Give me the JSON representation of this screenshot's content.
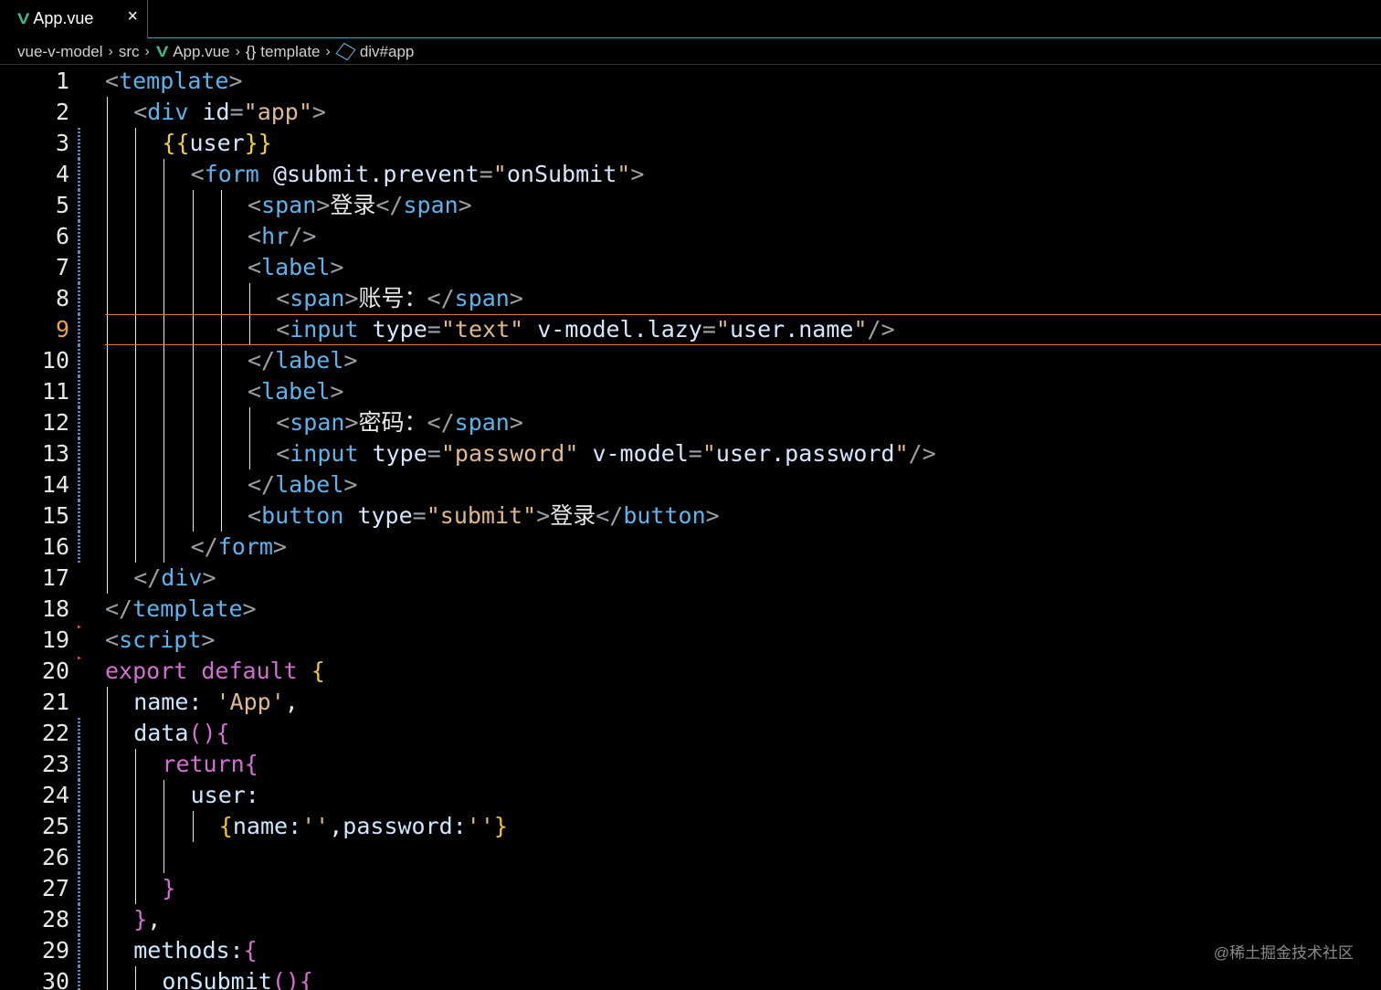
{
  "tab": {
    "icon": "vue-logo-icon",
    "label": "App.vue",
    "close": "×"
  },
  "breadcrumb": {
    "project": "vue-v-model",
    "folder": "src",
    "file": "App.vue",
    "section_icon": "{}",
    "section": "template",
    "element": "div#app"
  },
  "editor": {
    "active_line": 9,
    "lines": [
      {
        "n": "1",
        "indent": 0,
        "tokens": [
          [
            "t-punc",
            "<"
          ],
          [
            "t-tag",
            "template"
          ],
          [
            "t-punc",
            ">"
          ]
        ]
      },
      {
        "n": "2",
        "indent": 1,
        "tokens": [
          [
            "t-punc",
            "<"
          ],
          [
            "t-tag",
            "div"
          ],
          [
            "t-text",
            " "
          ],
          [
            "t-attr",
            "id"
          ],
          [
            "t-punc",
            "="
          ],
          [
            "t-str",
            "\"app\""
          ],
          [
            "t-punc",
            ">"
          ]
        ]
      },
      {
        "n": "3",
        "indent": 2,
        "tokens": [
          [
            "t-mus",
            "{{"
          ],
          [
            "t-attr",
            "user"
          ],
          [
            "t-mus",
            "}}"
          ]
        ]
      },
      {
        "n": "4",
        "indent": 3,
        "tokens": [
          [
            "t-punc",
            "<"
          ],
          [
            "t-tag",
            "form"
          ],
          [
            "t-text",
            " "
          ],
          [
            "t-attr",
            "@submit.prevent"
          ],
          [
            "t-punc",
            "="
          ],
          [
            "t-str",
            "\""
          ],
          [
            "t-attr",
            "onSubmit"
          ],
          [
            "t-str",
            "\""
          ],
          [
            "t-punc",
            ">"
          ]
        ]
      },
      {
        "n": "5",
        "indent": 5,
        "tokens": [
          [
            "t-punc",
            "<"
          ],
          [
            "t-tag",
            "span"
          ],
          [
            "t-punc",
            ">"
          ],
          [
            "t-text",
            "登录"
          ],
          [
            "t-punc",
            "</"
          ],
          [
            "t-tag",
            "span"
          ],
          [
            "t-punc",
            ">"
          ]
        ]
      },
      {
        "n": "6",
        "indent": 5,
        "tokens": [
          [
            "t-punc",
            "<"
          ],
          [
            "t-tag",
            "hr"
          ],
          [
            "t-punc",
            "/>"
          ]
        ]
      },
      {
        "n": "7",
        "indent": 5,
        "tokens": [
          [
            "t-punc",
            "<"
          ],
          [
            "t-tag",
            "label"
          ],
          [
            "t-punc",
            ">"
          ]
        ]
      },
      {
        "n": "8",
        "indent": 6,
        "tokens": [
          [
            "t-punc",
            "<"
          ],
          [
            "t-tag",
            "span"
          ],
          [
            "t-punc",
            ">"
          ],
          [
            "t-text",
            "账号："
          ],
          [
            "t-punc",
            "</"
          ],
          [
            "t-tag",
            "span"
          ],
          [
            "t-punc",
            ">"
          ]
        ]
      },
      {
        "n": "9",
        "indent": 6,
        "tokens": [
          [
            "t-punc",
            "<"
          ],
          [
            "t-tag",
            "input"
          ],
          [
            "t-text",
            " "
          ],
          [
            "t-attr",
            "type"
          ],
          [
            "t-punc",
            "="
          ],
          [
            "t-str",
            "\"text\""
          ],
          [
            "t-text",
            " "
          ],
          [
            "t-attr",
            "v-model.lazy"
          ],
          [
            "t-punc",
            "="
          ],
          [
            "t-str",
            "\""
          ],
          [
            "t-attr",
            "user.name"
          ],
          [
            "t-str",
            "\""
          ],
          [
            "t-punc",
            "/>"
          ]
        ]
      },
      {
        "n": "10",
        "indent": 5,
        "tokens": [
          [
            "t-punc",
            "</"
          ],
          [
            "t-tag",
            "label"
          ],
          [
            "t-punc",
            ">"
          ]
        ]
      },
      {
        "n": "11",
        "indent": 5,
        "tokens": [
          [
            "t-punc",
            "<"
          ],
          [
            "t-tag",
            "label"
          ],
          [
            "t-punc",
            ">"
          ]
        ]
      },
      {
        "n": "12",
        "indent": 6,
        "tokens": [
          [
            "t-punc",
            "<"
          ],
          [
            "t-tag",
            "span"
          ],
          [
            "t-punc",
            ">"
          ],
          [
            "t-text",
            "密码："
          ],
          [
            "t-punc",
            "</"
          ],
          [
            "t-tag",
            "span"
          ],
          [
            "t-punc",
            ">"
          ]
        ]
      },
      {
        "n": "13",
        "indent": 6,
        "tokens": [
          [
            "t-punc",
            "<"
          ],
          [
            "t-tag",
            "input"
          ],
          [
            "t-text",
            " "
          ],
          [
            "t-attr",
            "type"
          ],
          [
            "t-punc",
            "="
          ],
          [
            "t-str",
            "\"password\""
          ],
          [
            "t-text",
            " "
          ],
          [
            "t-attr",
            "v-model"
          ],
          [
            "t-punc",
            "="
          ],
          [
            "t-str",
            "\""
          ],
          [
            "t-attr",
            "user.password"
          ],
          [
            "t-str",
            "\""
          ],
          [
            "t-punc",
            "/>"
          ]
        ]
      },
      {
        "n": "14",
        "indent": 5,
        "tokens": [
          [
            "t-punc",
            "</"
          ],
          [
            "t-tag",
            "label"
          ],
          [
            "t-punc",
            ">"
          ]
        ]
      },
      {
        "n": "15",
        "indent": 5,
        "tokens": [
          [
            "t-punc",
            "<"
          ],
          [
            "t-tag",
            "button"
          ],
          [
            "t-text",
            " "
          ],
          [
            "t-attr",
            "type"
          ],
          [
            "t-punc",
            "="
          ],
          [
            "t-str",
            "\"submit\""
          ],
          [
            "t-punc",
            ">"
          ],
          [
            "t-text",
            "登录"
          ],
          [
            "t-punc",
            "</"
          ],
          [
            "t-tag",
            "button"
          ],
          [
            "t-punc",
            ">"
          ]
        ]
      },
      {
        "n": "16",
        "indent": 3,
        "tokens": [
          [
            "t-punc",
            "</"
          ],
          [
            "t-tag",
            "form"
          ],
          [
            "t-punc",
            ">"
          ]
        ]
      },
      {
        "n": "17",
        "indent": 1,
        "tokens": [
          [
            "t-punc",
            "</"
          ],
          [
            "t-tag",
            "div"
          ],
          [
            "t-punc",
            ">"
          ]
        ]
      },
      {
        "n": "18",
        "indent": 0,
        "tokens": [
          [
            "t-punc",
            "</"
          ],
          [
            "t-tag",
            "template"
          ],
          [
            "t-punc",
            ">"
          ]
        ]
      },
      {
        "n": "19",
        "indent": 0,
        "tokens": [
          [
            "t-punc",
            "<"
          ],
          [
            "t-tag",
            "script"
          ],
          [
            "t-punc",
            ">"
          ]
        ]
      },
      {
        "n": "20",
        "indent": 0,
        "tokens": [
          [
            "t-kw",
            "export default"
          ],
          [
            "t-text",
            " "
          ],
          [
            "t-brace",
            "{"
          ]
        ]
      },
      {
        "n": "21",
        "indent": 1,
        "tokens": [
          [
            "t-prop",
            "name: "
          ],
          [
            "t-str",
            "'App'"
          ],
          [
            "t-text",
            ","
          ]
        ]
      },
      {
        "n": "22",
        "indent": 1,
        "tokens": [
          [
            "t-prop",
            "data"
          ],
          [
            "t-brace2",
            "(){"
          ]
        ]
      },
      {
        "n": "23",
        "indent": 2,
        "tokens": [
          [
            "t-kw",
            "return"
          ],
          [
            "t-brace2",
            "{"
          ]
        ]
      },
      {
        "n": "24",
        "indent": 3,
        "tokens": [
          [
            "t-prop",
            "user:"
          ]
        ]
      },
      {
        "n": "25",
        "indent": 4,
        "tokens": [
          [
            "t-brace",
            "{"
          ],
          [
            "t-prop",
            "name:"
          ],
          [
            "t-str",
            "''"
          ],
          [
            "t-text",
            ","
          ],
          [
            "t-prop",
            "password:"
          ],
          [
            "t-str",
            "''"
          ],
          [
            "t-brace",
            "}"
          ]
        ]
      },
      {
        "n": "26",
        "indent": 0,
        "tokens": []
      },
      {
        "n": "27",
        "indent": 2,
        "tokens": [
          [
            "t-brace2",
            "}"
          ]
        ]
      },
      {
        "n": "28",
        "indent": 1,
        "tokens": [
          [
            "t-brace2",
            "}"
          ],
          [
            "t-text",
            ","
          ]
        ]
      },
      {
        "n": "29",
        "indent": 1,
        "tokens": [
          [
            "t-prop",
            "methods:"
          ],
          [
            "t-brace2",
            "{"
          ]
        ]
      },
      {
        "n": "30",
        "indent": 2,
        "tokens": [
          [
            "t-prop",
            "onSubmit"
          ],
          [
            "t-brace2",
            "(){"
          ]
        ]
      }
    ]
  },
  "watermark": "@稀土掘金技术社区"
}
